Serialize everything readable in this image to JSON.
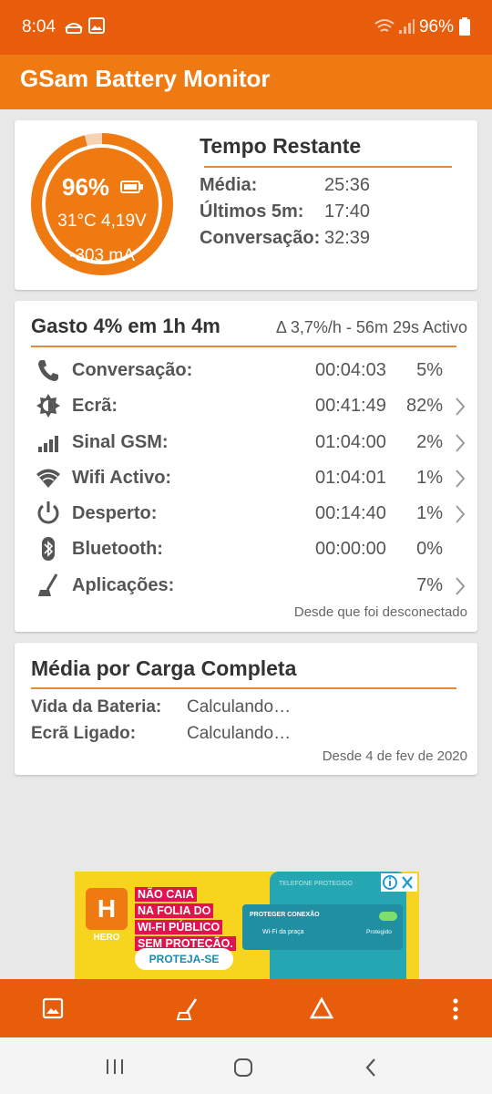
{
  "status_bar": {
    "time": "8:04",
    "battery_percent": "96%"
  },
  "app": {
    "title": "GSam Battery Monitor",
    "accent_color": "#f07a12",
    "status_color": "#e85d0c"
  },
  "gauge": {
    "percent": "96%",
    "level_fraction": 0.96,
    "temp_voltage": "31°C  4,19V",
    "current": "-303 mA"
  },
  "tempo_restante": {
    "title": "Tempo Restante",
    "rows": [
      {
        "label": "Média:",
        "value": "25:36"
      },
      {
        "label": "Últimos 5m:",
        "value": "17:40"
      },
      {
        "label": "Conversação:",
        "value": "32:39"
      }
    ]
  },
  "gasto": {
    "title": "Gasto 4% em 1h 4m",
    "rate": "Δ 3,7%/h - 56m 29s Activo",
    "rows": [
      {
        "icon": "phone-icon",
        "label": "Conversação:",
        "duration": "00:04:03",
        "percent": "5%",
        "chevron": false
      },
      {
        "icon": "brightness-icon",
        "label": "Ecrã:",
        "duration": "00:41:49",
        "percent": "82%",
        "chevron": true
      },
      {
        "icon": "signal-icon",
        "label": "Sinal GSM:",
        "duration": "01:04:00",
        "percent": "2%",
        "chevron": true
      },
      {
        "icon": "wifi-icon",
        "label": "Wifi Activo:",
        "duration": "01:04:01",
        "percent": "1%",
        "chevron": true
      },
      {
        "icon": "power-icon",
        "label": "Desperto:",
        "duration": "00:14:40",
        "percent": "1%",
        "chevron": true
      },
      {
        "icon": "bluetooth-icon",
        "label": "Bluetooth:",
        "duration": "00:00:00",
        "percent": "0%",
        "chevron": false
      },
      {
        "icon": "broom-icon",
        "label": "Aplicações:",
        "duration": "",
        "percent": "7%",
        "chevron": true
      }
    ],
    "footer": "Desde que foi desconectado"
  },
  "media_carga": {
    "title": "Média por Carga Completa",
    "rows": [
      {
        "label": "Vida da Bateria:",
        "value": "Calculando…"
      },
      {
        "label": "Ecrã Ligado:",
        "value": "Calculando…"
      }
    ],
    "footer": "Desde 4 de fev de 2020"
  },
  "ad": {
    "brand": "HERO",
    "logo_letter": "H",
    "headline": [
      "NÃO CAIA",
      "NA FOLIA DO",
      "WI-FI PÚBLICO",
      "SEM PROTEÇÃO."
    ],
    "cta": "PROTEJA-SE",
    "phone_header": "TELEFONE PROTEGIDO",
    "panel_title": "PROTEGER CONEXÃO",
    "panel_sub": "Wi-Fi da praça",
    "panel_status": "Protegido"
  },
  "bottom_bar": {
    "icons": [
      "image-icon",
      "broom-icon",
      "triangle-icon",
      "more-icon"
    ]
  },
  "nav_bar": {
    "icons": [
      "recents-icon",
      "home-icon",
      "back-icon"
    ]
  }
}
